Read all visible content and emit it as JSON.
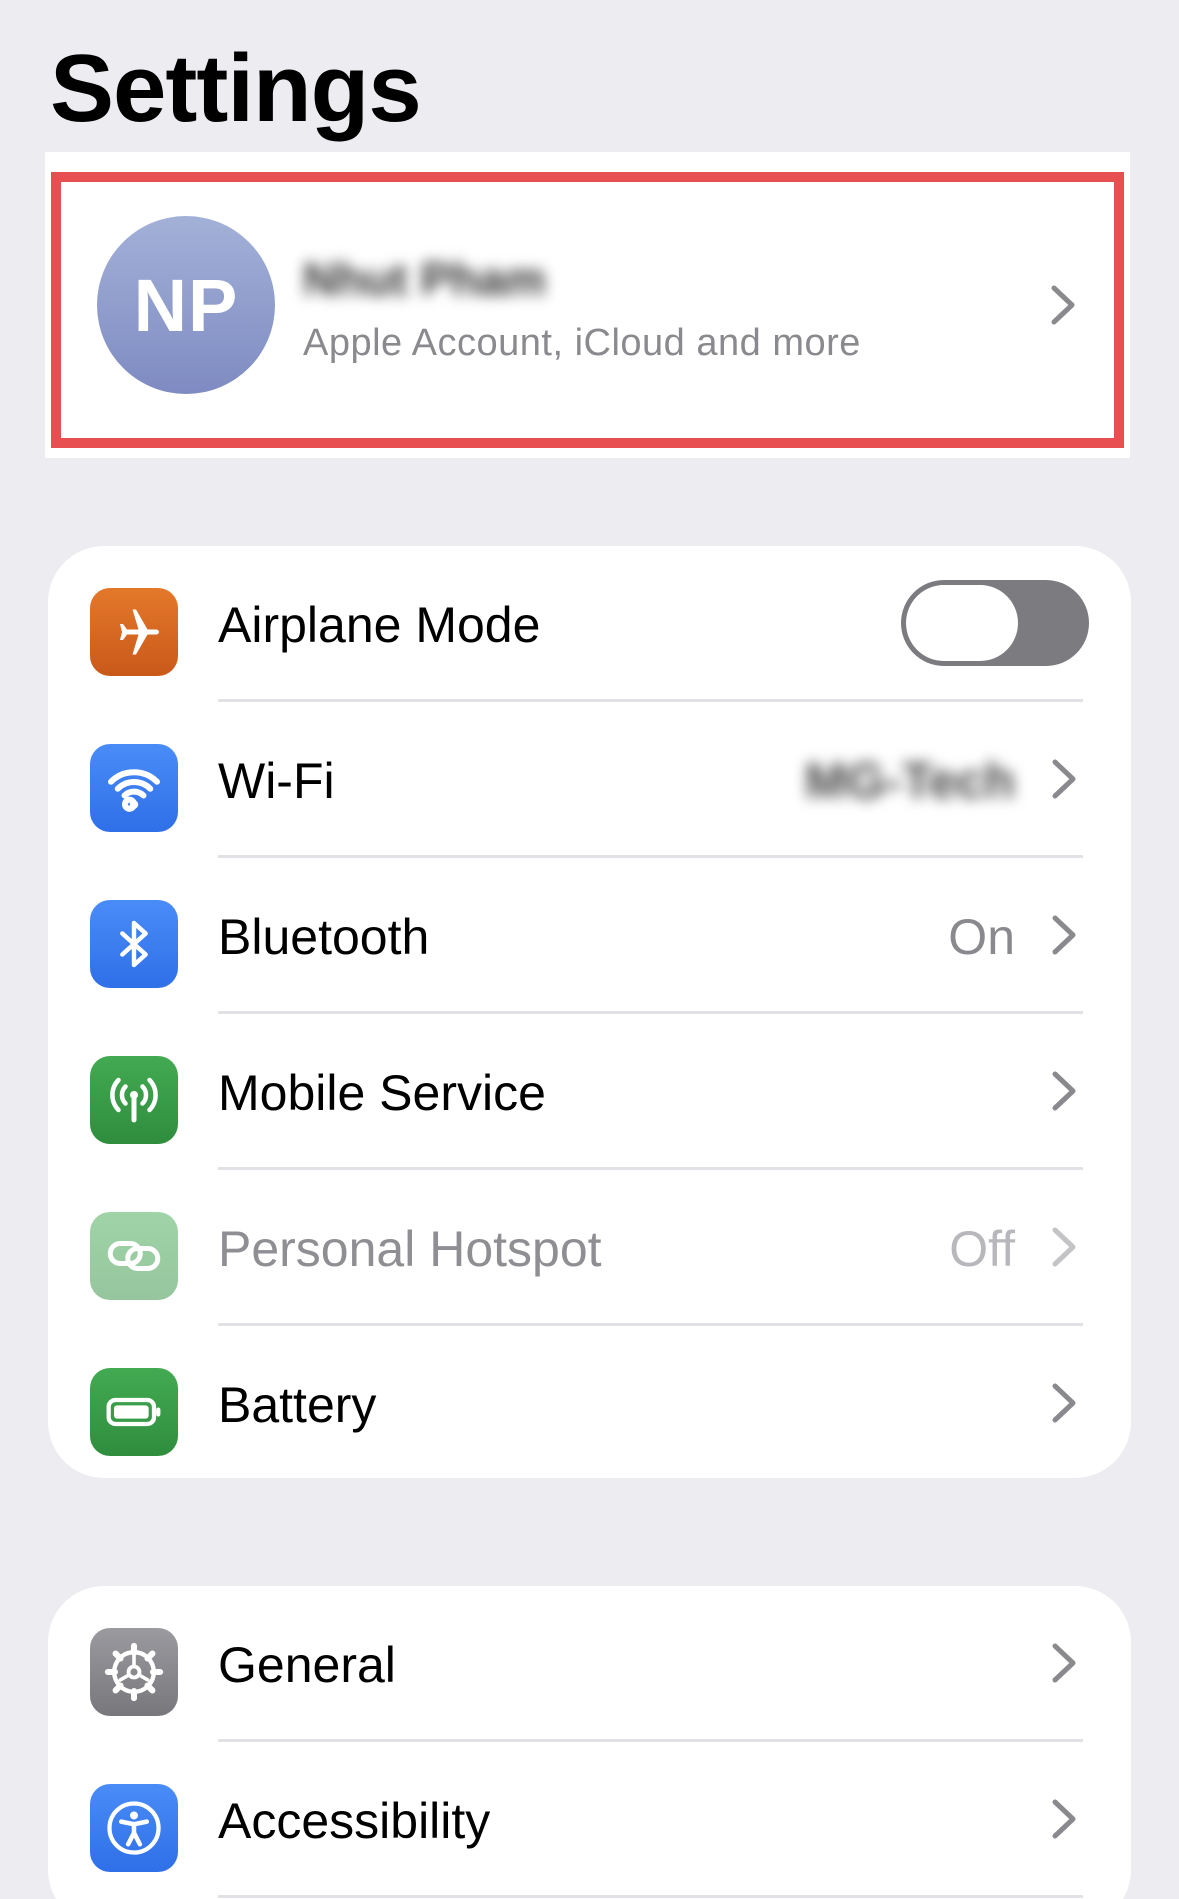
{
  "page": {
    "title": "Settings"
  },
  "account": {
    "initials": "NP",
    "name": "Nhut Pham",
    "subtitle": "Apple Account, iCloud and more"
  },
  "group1": {
    "items": [
      {
        "label": "Airplane Mode",
        "icon": "airplane-icon",
        "color": "#d9691e",
        "toggle": false
      },
      {
        "label": "Wi-Fi",
        "icon": "wifi-icon",
        "color": "#3478f6",
        "value": "MG-Tech"
      },
      {
        "label": "Bluetooth",
        "icon": "bluetooth-icon",
        "color": "#3478f6",
        "value": "On"
      },
      {
        "label": "Mobile Service",
        "icon": "antenna-icon",
        "color": "#35a045"
      },
      {
        "label": "Personal Hotspot",
        "icon": "link-icon",
        "color": "#35a045",
        "value": "Off",
        "disabled": true
      },
      {
        "label": "Battery",
        "icon": "battery-icon",
        "color": "#35a045"
      }
    ]
  },
  "group2": {
    "items": [
      {
        "label": "General",
        "icon": "gear-icon",
        "color": "#8e8e93"
      },
      {
        "label": "Accessibility",
        "icon": "accessibility-icon",
        "color": "#3478f6"
      }
    ]
  },
  "colors": {
    "background": "#ececf1",
    "highlight": "#e84f50",
    "chevron": "#8a8a8e"
  }
}
